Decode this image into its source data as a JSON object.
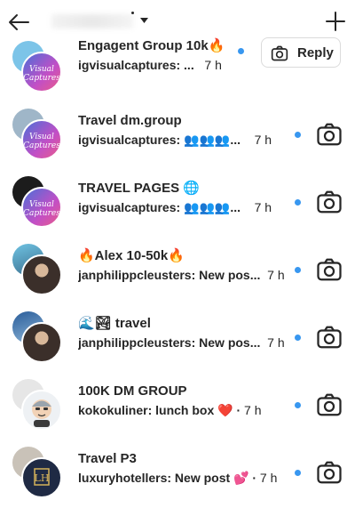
{
  "header": {
    "back_icon": "arrow-left-icon",
    "new_icon": "plus-icon"
  },
  "threads": [
    {
      "name": "Engagent Group 10k🔥",
      "preview": "igvisualcaptures: ...",
      "time": "7 h",
      "action": "Reply"
    },
    {
      "name": "Travel dm.group",
      "preview": "igvisualcaptures: 👥👥👥...",
      "time": "7 h",
      "action": "camera"
    },
    {
      "name": "TRAVEL PAGES 🌐",
      "preview": "igvisualcaptures: 👥👥👥...",
      "time": "7 h",
      "action": "camera"
    },
    {
      "name": "🔥Alex 10-50k🔥",
      "preview": "janphilippcleusters: New pos...",
      "time": "7 h",
      "action": "camera"
    },
    {
      "name": "🌊🏞 travel",
      "preview": "janphilippcleusters: New pos...",
      "time": "7 h",
      "action": "camera"
    },
    {
      "name": "100K DM GROUP",
      "preview": "kokokuliner: lunch box ❤️ ·",
      "time": "7 h",
      "action": "camera"
    },
    {
      "name": "Travel P3",
      "preview": "luxuryhotellers: New post 💕 ·",
      "time": "7 h",
      "action": "camera"
    }
  ],
  "colors": {
    "unread_dot": "#3897f0",
    "text": "#262626",
    "border": "#dbdbdb"
  }
}
